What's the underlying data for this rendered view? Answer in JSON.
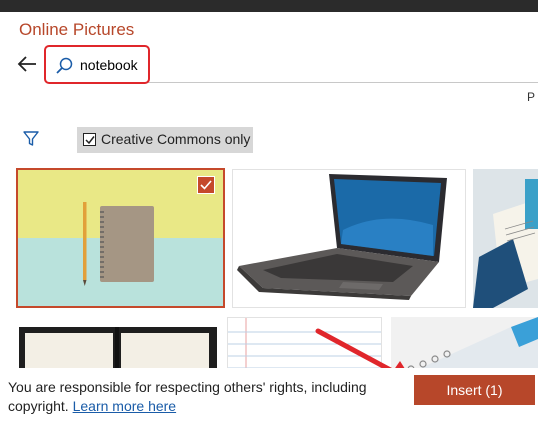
{
  "dialog": {
    "title": "Online Pictures",
    "cut_letter": "P"
  },
  "search": {
    "value": "notebook"
  },
  "filter": {
    "creative_commons_label": "Creative Commons only",
    "creative_commons_checked": true
  },
  "results": {
    "thumbnails": [
      {
        "subject": "notebook and pencil on yellow and mint background",
        "selected": true
      },
      {
        "subject": "laptop computer",
        "selected": false
      },
      {
        "subject": "notebooks on blue surface (partial)",
        "selected": false
      },
      {
        "subject": "open black notebook (partial)",
        "selected": false
      },
      {
        "subject": "lined paper (partial)",
        "selected": false
      },
      {
        "subject": "spiral notebook (partial)",
        "selected": false
      }
    ]
  },
  "footer": {
    "disclaimer": "You are responsible for respecting others' rights, including copyright.",
    "learn_more": "Learn more here",
    "insert_label": "Insert (1)"
  },
  "colors": {
    "accent": "#b7472a",
    "highlight_red": "#e0262b",
    "link": "#1a5ca8"
  }
}
